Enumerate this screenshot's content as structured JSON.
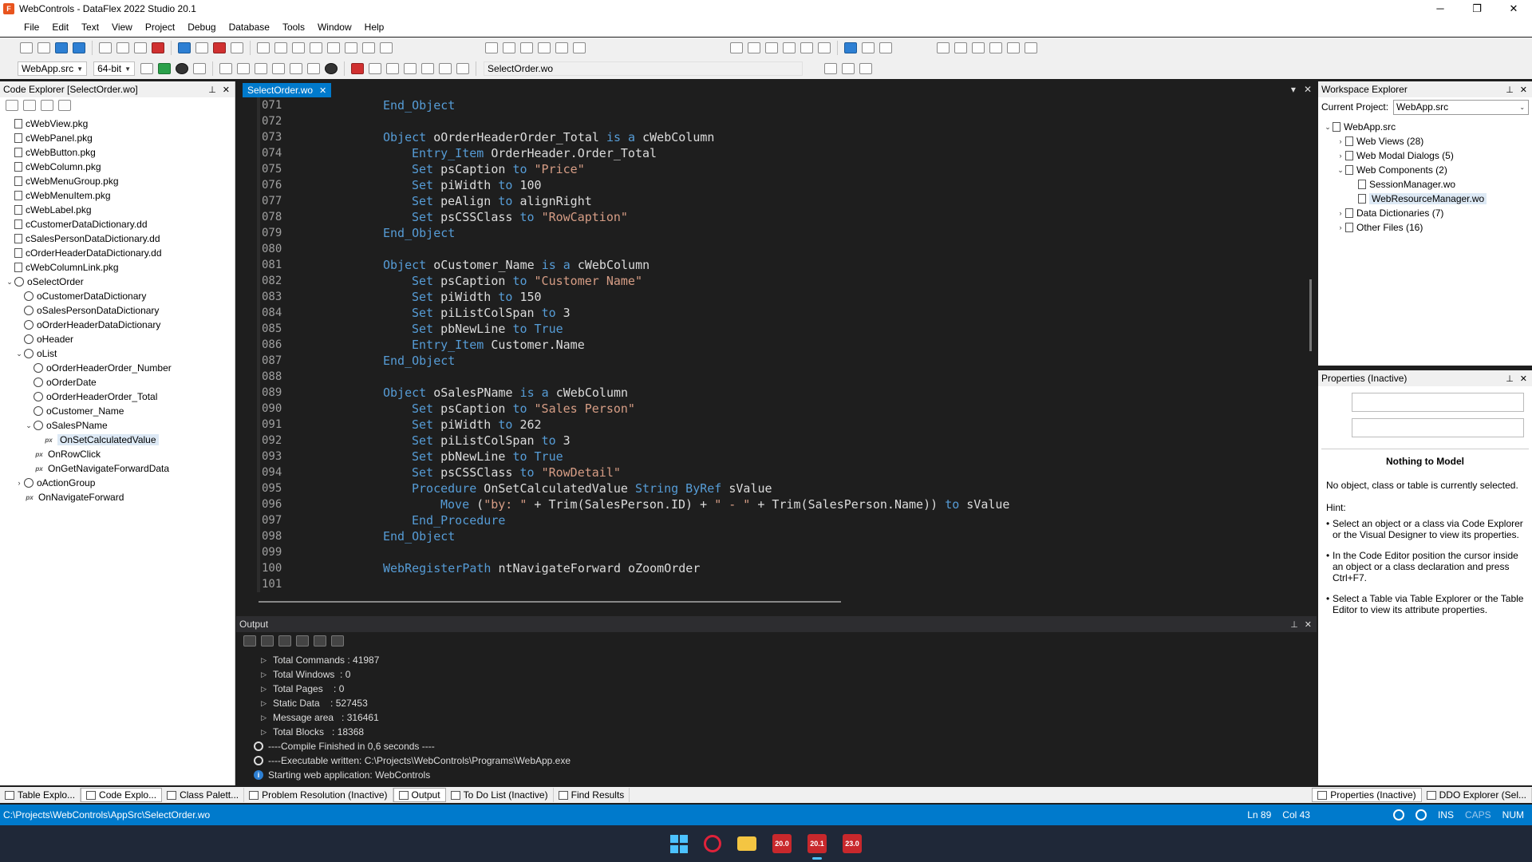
{
  "window": {
    "title": "WebControls - DataFlex 2022 Studio 20.1",
    "minimize": "─",
    "maximize": "❐",
    "close": "✕"
  },
  "menu": [
    "File",
    "Edit",
    "Text",
    "View",
    "Project",
    "Debug",
    "Database",
    "Tools",
    "Window",
    "Help"
  ],
  "toolbar": {
    "workspace_combo": "WebApp.src",
    "platform_combo": "64-bit",
    "file_combo": "SelectOrder.wo"
  },
  "code_explorer": {
    "title": "Code Explorer [SelectOrder.wo]",
    "pin": "⊥",
    "close": "✕",
    "items": [
      {
        "label": "cWebView.pkg",
        "depth": 0,
        "icon": "file",
        "twisty": ""
      },
      {
        "label": "cWebPanel.pkg",
        "depth": 0,
        "icon": "file",
        "twisty": ""
      },
      {
        "label": "cWebButton.pkg",
        "depth": 0,
        "icon": "file",
        "twisty": ""
      },
      {
        "label": "cWebColumn.pkg",
        "depth": 0,
        "icon": "file",
        "twisty": ""
      },
      {
        "label": "cWebMenuGroup.pkg",
        "depth": 0,
        "icon": "file",
        "twisty": ""
      },
      {
        "label": "cWebMenuItem.pkg",
        "depth": 0,
        "icon": "file",
        "twisty": ""
      },
      {
        "label": "cWebLabel.pkg",
        "depth": 0,
        "icon": "file",
        "twisty": ""
      },
      {
        "label": "cCustomerDataDictionary.dd",
        "depth": 0,
        "icon": "file",
        "twisty": ""
      },
      {
        "label": "cSalesPersonDataDictionary.dd",
        "depth": 0,
        "icon": "file",
        "twisty": ""
      },
      {
        "label": "cOrderHeaderDataDictionary.dd",
        "depth": 0,
        "icon": "file",
        "twisty": ""
      },
      {
        "label": "cWebColumnLink.pkg",
        "depth": 0,
        "icon": "file",
        "twisty": ""
      },
      {
        "label": "oSelectOrder",
        "depth": 0,
        "icon": "gear",
        "twisty": "⌄"
      },
      {
        "label": "oCustomerDataDictionary",
        "depth": 1,
        "icon": "gear",
        "twisty": ""
      },
      {
        "label": "oSalesPersonDataDictionary",
        "depth": 1,
        "icon": "gear",
        "twisty": ""
      },
      {
        "label": "oOrderHeaderDataDictionary",
        "depth": 1,
        "icon": "gear",
        "twisty": ""
      },
      {
        "label": "oHeader",
        "depth": 1,
        "icon": "gear",
        "twisty": ""
      },
      {
        "label": "oList",
        "depth": 1,
        "icon": "gear",
        "twisty": "⌄"
      },
      {
        "label": "oOrderHeaderOrder_Number",
        "depth": 2,
        "icon": "gear",
        "twisty": ""
      },
      {
        "label": "oOrderDate",
        "depth": 2,
        "icon": "gear",
        "twisty": ""
      },
      {
        "label": "oOrderHeaderOrder_Total",
        "depth": 2,
        "icon": "gear",
        "twisty": ""
      },
      {
        "label": "oCustomer_Name",
        "depth": 2,
        "icon": "gear",
        "twisty": ""
      },
      {
        "label": "oSalesPName",
        "depth": 2,
        "icon": "gear",
        "twisty": "⌄"
      },
      {
        "label": "OnSetCalculatedValue",
        "depth": 3,
        "icon": "fn",
        "twisty": "",
        "selected": true
      },
      {
        "label": "OnRowClick",
        "depth": 2,
        "icon": "fn",
        "twisty": ""
      },
      {
        "label": "OnGetNavigateForwardData",
        "depth": 2,
        "icon": "fn",
        "twisty": ""
      },
      {
        "label": "oActionGroup",
        "depth": 1,
        "icon": "gear",
        "twisty": "›"
      },
      {
        "label": "OnNavigateForward",
        "depth": 1,
        "icon": "fn",
        "twisty": ""
      }
    ]
  },
  "editor": {
    "tab": "SelectOrder.wo",
    "tab_close": "✕",
    "tab_menu": "▾",
    "tab_close_all": "✕",
    "lines": [
      {
        "n": "071",
        "indent": 8,
        "tokens": [
          [
            "kw",
            "End_Object"
          ]
        ]
      },
      {
        "n": "072",
        "indent": 0,
        "tokens": []
      },
      {
        "n": "073",
        "indent": 8,
        "tokens": [
          [
            "kw",
            "Object"
          ],
          [
            "ident",
            " oOrderHeaderOrder_Total "
          ],
          [
            "kw",
            "is a"
          ],
          [
            "ident",
            " cWebColumn"
          ]
        ]
      },
      {
        "n": "074",
        "indent": 12,
        "tokens": [
          [
            "kw",
            "Entry_Item"
          ],
          [
            "ident",
            " OrderHeader.Order_Total"
          ]
        ]
      },
      {
        "n": "075",
        "indent": 12,
        "tokens": [
          [
            "kw",
            "Set"
          ],
          [
            "ident",
            " psCaption "
          ],
          [
            "kw",
            "to"
          ],
          [
            "ident",
            " "
          ],
          [
            "str",
            "\"Price\""
          ]
        ]
      },
      {
        "n": "076",
        "indent": 12,
        "tokens": [
          [
            "kw",
            "Set"
          ],
          [
            "ident",
            " piWidth "
          ],
          [
            "kw",
            "to"
          ],
          [
            "ident",
            " 100"
          ]
        ]
      },
      {
        "n": "077",
        "indent": 12,
        "tokens": [
          [
            "kw",
            "Set"
          ],
          [
            "ident",
            " peAlign "
          ],
          [
            "kw",
            "to"
          ],
          [
            "ident",
            " alignRight"
          ]
        ]
      },
      {
        "n": "078",
        "indent": 12,
        "tokens": [
          [
            "kw",
            "Set"
          ],
          [
            "ident",
            " psCSSClass "
          ],
          [
            "kw",
            "to"
          ],
          [
            "ident",
            " "
          ],
          [
            "str",
            "\"RowCaption\""
          ]
        ]
      },
      {
        "n": "079",
        "indent": 8,
        "tokens": [
          [
            "kw",
            "End_Object"
          ]
        ]
      },
      {
        "n": "080",
        "indent": 0,
        "tokens": []
      },
      {
        "n": "081",
        "indent": 8,
        "tokens": [
          [
            "kw",
            "Object"
          ],
          [
            "ident",
            " oCustomer_Name "
          ],
          [
            "kw",
            "is a"
          ],
          [
            "ident",
            " cWebColumn"
          ]
        ]
      },
      {
        "n": "082",
        "indent": 12,
        "tokens": [
          [
            "kw",
            "Set"
          ],
          [
            "ident",
            " psCaption "
          ],
          [
            "kw",
            "to"
          ],
          [
            "ident",
            " "
          ],
          [
            "str",
            "\"Customer Name\""
          ]
        ]
      },
      {
        "n": "083",
        "indent": 12,
        "tokens": [
          [
            "kw",
            "Set"
          ],
          [
            "ident",
            " piWidth "
          ],
          [
            "kw",
            "to"
          ],
          [
            "ident",
            " 150"
          ]
        ]
      },
      {
        "n": "084",
        "indent": 12,
        "tokens": [
          [
            "kw",
            "Set"
          ],
          [
            "ident",
            " piListColSpan "
          ],
          [
            "kw",
            "to"
          ],
          [
            "ident",
            " 3"
          ]
        ]
      },
      {
        "n": "085",
        "indent": 12,
        "tokens": [
          [
            "kw",
            "Set"
          ],
          [
            "ident",
            " pbNewLine "
          ],
          [
            "kw",
            "to"
          ],
          [
            "ident",
            " "
          ],
          [
            "kw",
            "True"
          ]
        ]
      },
      {
        "n": "086",
        "indent": 12,
        "tokens": [
          [
            "kw",
            "Entry_Item"
          ],
          [
            "ident",
            " Customer.Name"
          ]
        ]
      },
      {
        "n": "087",
        "indent": 8,
        "tokens": [
          [
            "kw",
            "End_Object"
          ]
        ]
      },
      {
        "n": "088",
        "indent": 0,
        "tokens": []
      },
      {
        "n": "089",
        "indent": 8,
        "tokens": [
          [
            "kw",
            "Object"
          ],
          [
            "ident",
            " oSalesPName "
          ],
          [
            "kw",
            "is a"
          ],
          [
            "ident",
            " cWebColumn"
          ]
        ]
      },
      {
        "n": "090",
        "indent": 12,
        "tokens": [
          [
            "kw",
            "Set"
          ],
          [
            "ident",
            " psCaption "
          ],
          [
            "kw",
            "to"
          ],
          [
            "ident",
            " "
          ],
          [
            "str",
            "\"Sales Person\""
          ]
        ]
      },
      {
        "n": "091",
        "indent": 12,
        "tokens": [
          [
            "kw",
            "Set"
          ],
          [
            "ident",
            " piWidth "
          ],
          [
            "kw",
            "to"
          ],
          [
            "ident",
            " 262"
          ]
        ]
      },
      {
        "n": "092",
        "indent": 12,
        "tokens": [
          [
            "kw",
            "Set"
          ],
          [
            "ident",
            " piListColSpan "
          ],
          [
            "kw",
            "to"
          ],
          [
            "ident",
            " 3"
          ]
        ]
      },
      {
        "n": "093",
        "indent": 12,
        "tokens": [
          [
            "kw",
            "Set"
          ],
          [
            "ident",
            " pbNewLine "
          ],
          [
            "kw",
            "to"
          ],
          [
            "ident",
            " "
          ],
          [
            "kw",
            "True"
          ]
        ]
      },
      {
        "n": "094",
        "indent": 12,
        "tokens": [
          [
            "kw",
            "Set"
          ],
          [
            "ident",
            " psCSSClass "
          ],
          [
            "kw",
            "to"
          ],
          [
            "ident",
            " "
          ],
          [
            "str",
            "\"RowDetail\""
          ]
        ]
      },
      {
        "n": "095",
        "indent": 12,
        "tokens": [
          [
            "kw",
            "Procedure"
          ],
          [
            "ident",
            " OnSetCalculatedValue "
          ],
          [
            "kw",
            "String ByRef"
          ],
          [
            "ident",
            " sValue"
          ]
        ]
      },
      {
        "n": "096",
        "indent": 16,
        "tokens": [
          [
            "kw",
            "Move"
          ],
          [
            "ident",
            " ("
          ],
          [
            "str",
            "\"by: \""
          ],
          [
            "ident",
            " + Trim(SalesPerson.ID) + "
          ],
          [
            "str",
            "\" - \""
          ],
          [
            "ident",
            " + Trim(SalesPerson.Name)) "
          ],
          [
            "kw",
            "to"
          ],
          [
            "ident",
            " sValue"
          ]
        ]
      },
      {
        "n": "097",
        "indent": 12,
        "tokens": [
          [
            "kw",
            "End_Procedure"
          ]
        ]
      },
      {
        "n": "098",
        "indent": 8,
        "tokens": [
          [
            "kw",
            "End_Object"
          ]
        ]
      },
      {
        "n": "099",
        "indent": 0,
        "tokens": []
      },
      {
        "n": "100",
        "indent": 8,
        "tokens": [
          [
            "kw",
            "WebRegisterPath"
          ],
          [
            "ident",
            " ntNavigateForward oZoomOrder"
          ]
        ]
      },
      {
        "n": "101",
        "indent": 0,
        "tokens": []
      }
    ]
  },
  "output": {
    "title": "Output",
    "pin": "⊥",
    "close": "✕",
    "lines": [
      {
        "kind": "tri",
        "text": "Total Commands : 41987"
      },
      {
        "kind": "tri",
        "text": "Total Windows  : 0"
      },
      {
        "kind": "tri",
        "text": "Total Pages    : 0"
      },
      {
        "kind": "tri",
        "text": "Static Data    : 527453"
      },
      {
        "kind": "tri",
        "text": "Message area   : 316461"
      },
      {
        "kind": "tri",
        "text": "Total Blocks   : 18368"
      },
      {
        "kind": "circle",
        "text": "----Compile Finished in 0,6 seconds ----"
      },
      {
        "kind": "circle",
        "text": "----Executable written: C:\\Projects\\WebControls\\Programs\\WebApp.exe"
      },
      {
        "kind": "info",
        "text": "Starting web application: WebControls"
      }
    ]
  },
  "workspace": {
    "title": "Workspace Explorer",
    "current_project_label": "Current Project:",
    "current_project": "WebApp.src",
    "pin": "⊥",
    "close": "✕",
    "items": [
      {
        "label": "WebApp.src",
        "depth": 0,
        "twisty": "⌄"
      },
      {
        "label": "Web Views (28)",
        "depth": 1,
        "twisty": "›"
      },
      {
        "label": "Web Modal Dialogs (5)",
        "depth": 1,
        "twisty": "›"
      },
      {
        "label": "Web Components (2)",
        "depth": 1,
        "twisty": "⌄"
      },
      {
        "label": "SessionManager.wo",
        "depth": 2,
        "twisty": ""
      },
      {
        "label": "WebResourceManager.wo",
        "depth": 2,
        "twisty": "",
        "selected": true
      },
      {
        "label": "Data Dictionaries (7)",
        "depth": 1,
        "twisty": "›"
      },
      {
        "label": "Other Files (16)",
        "depth": 1,
        "twisty": "›"
      }
    ]
  },
  "properties": {
    "title": "Properties (Inactive)",
    "pin": "⊥",
    "close": "✕",
    "heading": "Nothing to Model",
    "message": "No object, class or table is currently selected.",
    "hint_label": "Hint:",
    "hints": [
      "Select an object or a class via Code Explorer or the Visual Designer to view its properties.",
      "In the Code Editor position the cursor inside an object or a class declaration and press Ctrl+F7.",
      "Select a Table via Table Explorer or the Table Editor to view its attribute properties."
    ]
  },
  "bottom_tabs": {
    "left": [
      "Table Explo...",
      "Code Explo...",
      "Class Palett..."
    ],
    "center": [
      "Problem Resolution (Inactive)",
      "Output",
      "To Do List (Inactive)",
      "Find Results"
    ],
    "right": [
      "Properties (Inactive)",
      "DDO Explorer (Sel..."
    ]
  },
  "status": {
    "path": "C:\\Projects\\WebControls\\AppSrc\\SelectOrder.wo",
    "line": "Ln 89",
    "col": "Col 43",
    "ins": "INS",
    "caps": "CAPS",
    "num": "NUM"
  },
  "taskbar": {
    "df20": "20.0",
    "df201": "20.1",
    "df23": "23.0"
  },
  "colors": {
    "accent": "#007acc",
    "keyword": "#569cd6",
    "string": "#d69d85"
  }
}
